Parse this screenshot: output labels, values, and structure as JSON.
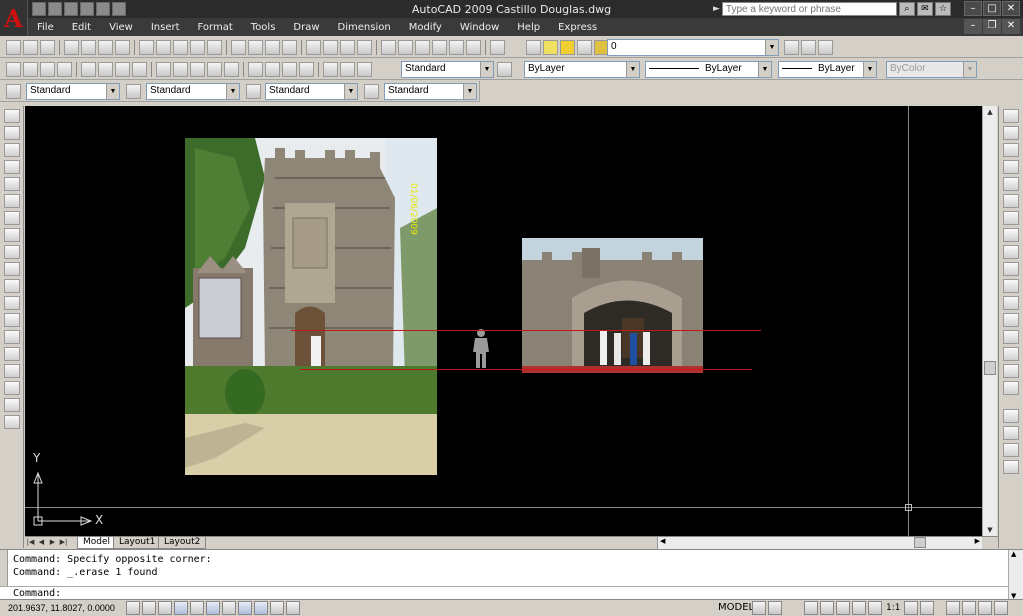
{
  "app": {
    "title": "AutoCAD 2009 Castillo Douglas.dwg",
    "search_placeholder": "Type a keyword or phrase"
  },
  "menu": [
    "File",
    "Edit",
    "View",
    "Insert",
    "Format",
    "Tools",
    "Draw",
    "Dimension",
    "Modify",
    "Window",
    "Help",
    "Express"
  ],
  "layers_toolbar": {
    "layer_value": "0"
  },
  "styles_toolbar": {
    "dim_style": "Standard",
    "text_style": "Standard",
    "table_style": "Standard",
    "table_style2": "Standard",
    "multileader_style": "Standard"
  },
  "properties_toolbar": {
    "color": "ByLayer",
    "linetype": "ByLayer",
    "lineweight": "ByLayer",
    "plotstyle": "ByColor"
  },
  "ucs": {
    "x_label": "X",
    "y_label": "Y"
  },
  "photo1_annotation": "01/06/2009",
  "tabs": {
    "model": "Model",
    "layout1": "Layout1",
    "layout2": "Layout2"
  },
  "command": {
    "line1": "Command: Specify opposite corner:",
    "line2": "Command: _.erase 1 found",
    "prompt": "Command:"
  },
  "status": {
    "coordinates": "201.9637, 11.8027, 0.0000",
    "space": "MODEL",
    "annotation_scale": "1:1"
  },
  "colors": {
    "canvas_bg": "#000000",
    "title_bg": "#2b2b2b",
    "menu_bg": "#3a3a3a",
    "guide_line": "#c01818"
  }
}
